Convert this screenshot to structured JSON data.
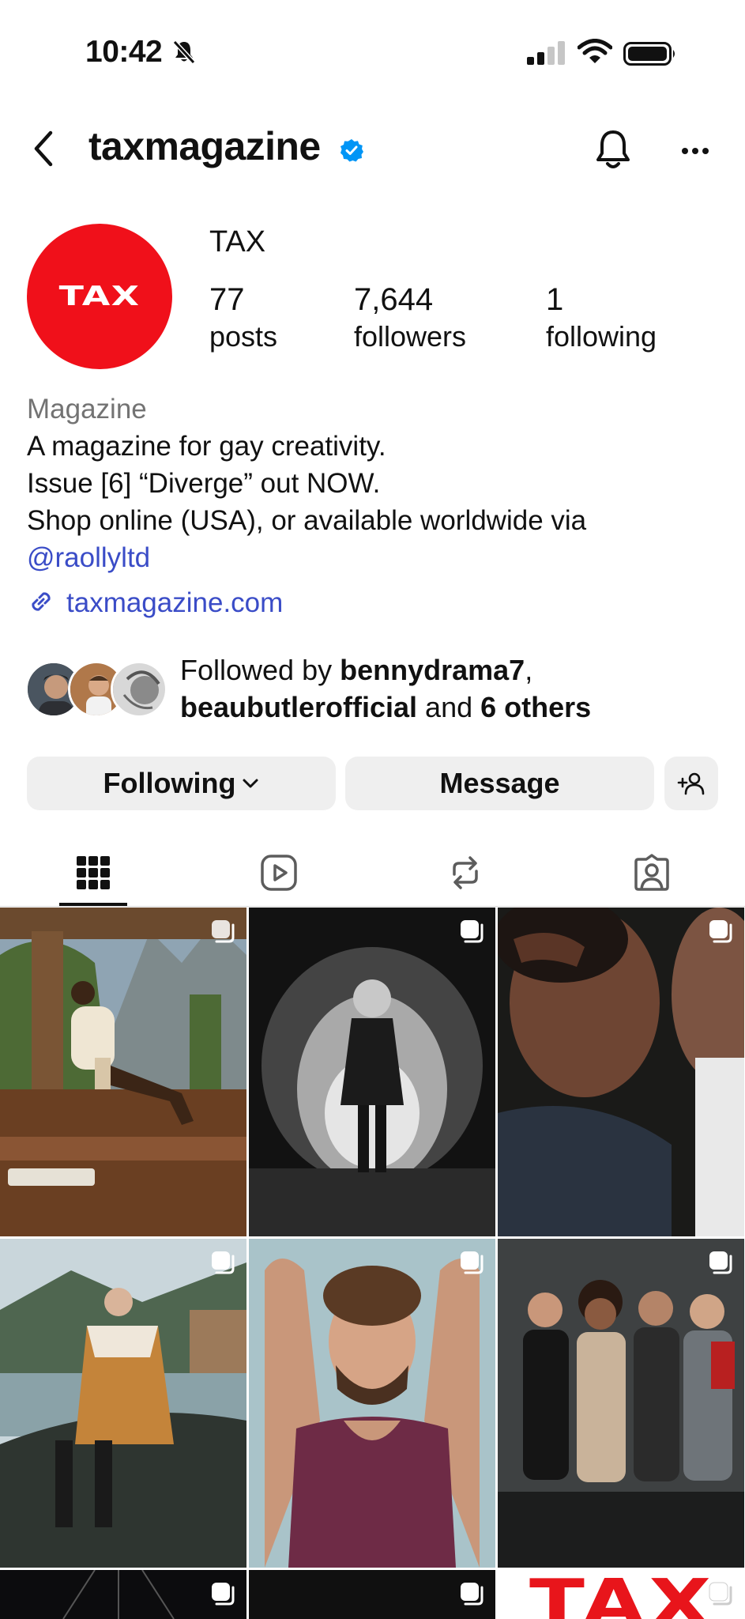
{
  "status_bar": {
    "time": "10:42",
    "icons": [
      "bell-slash-icon",
      "cellular-signal-icon",
      "wifi-icon",
      "battery-icon"
    ]
  },
  "header": {
    "username": "taxmagazine",
    "icons": [
      "back-chevron-icon",
      "verified-badge-icon",
      "notification-bell-icon",
      "more-dots-icon"
    ]
  },
  "profile": {
    "avatar_text": "TAX",
    "display_name": "TAX",
    "stats": [
      {
        "value": "77",
        "label": "posts"
      },
      {
        "value": "7,644",
        "label": "followers"
      },
      {
        "value": "1",
        "label": "following"
      }
    ]
  },
  "bio": {
    "category": "Magazine",
    "lines": [
      "A magazine for gay creativity.",
      "Issue [6] “Diverge” out NOW.",
      "Shop online (USA), or available worldwide via"
    ],
    "mention": "@raollyltd",
    "link": "taxmagazine.com"
  },
  "followed_by": {
    "prefix": "Followed by ",
    "user1": "bennydrama7",
    "sep": ",",
    "user2": "beaubutlerofficial",
    "and": " and ",
    "others": "6 others"
  },
  "buttons": {
    "following": "Following",
    "message": "Message"
  },
  "tabs": [
    "grid-icon",
    "reels-icon",
    "reposts-icon",
    "tagged-icon"
  ],
  "colors": {
    "accent_link": "#3a4cc7",
    "verified": "#0095f6",
    "avatar_red": "#f0101a",
    "button_bg": "#efefef"
  },
  "grid_posts": [
    {
      "subject": "man seated on wooden porch with mountains"
    },
    {
      "subject": "black and white figure walking into smoke"
    },
    {
      "subject": "close-up of two men, one kissing neck"
    },
    {
      "subject": "man in plaid blanket seated on rocks by lake"
    },
    {
      "subject": "curly haired man in purple tank top"
    },
    {
      "subject": "group of four young men posing"
    },
    {
      "subject": "dark post with light beams"
    },
    {
      "subject": "dark post"
    },
    {
      "subject": "TAX logo post",
      "text": "TAX"
    }
  ]
}
